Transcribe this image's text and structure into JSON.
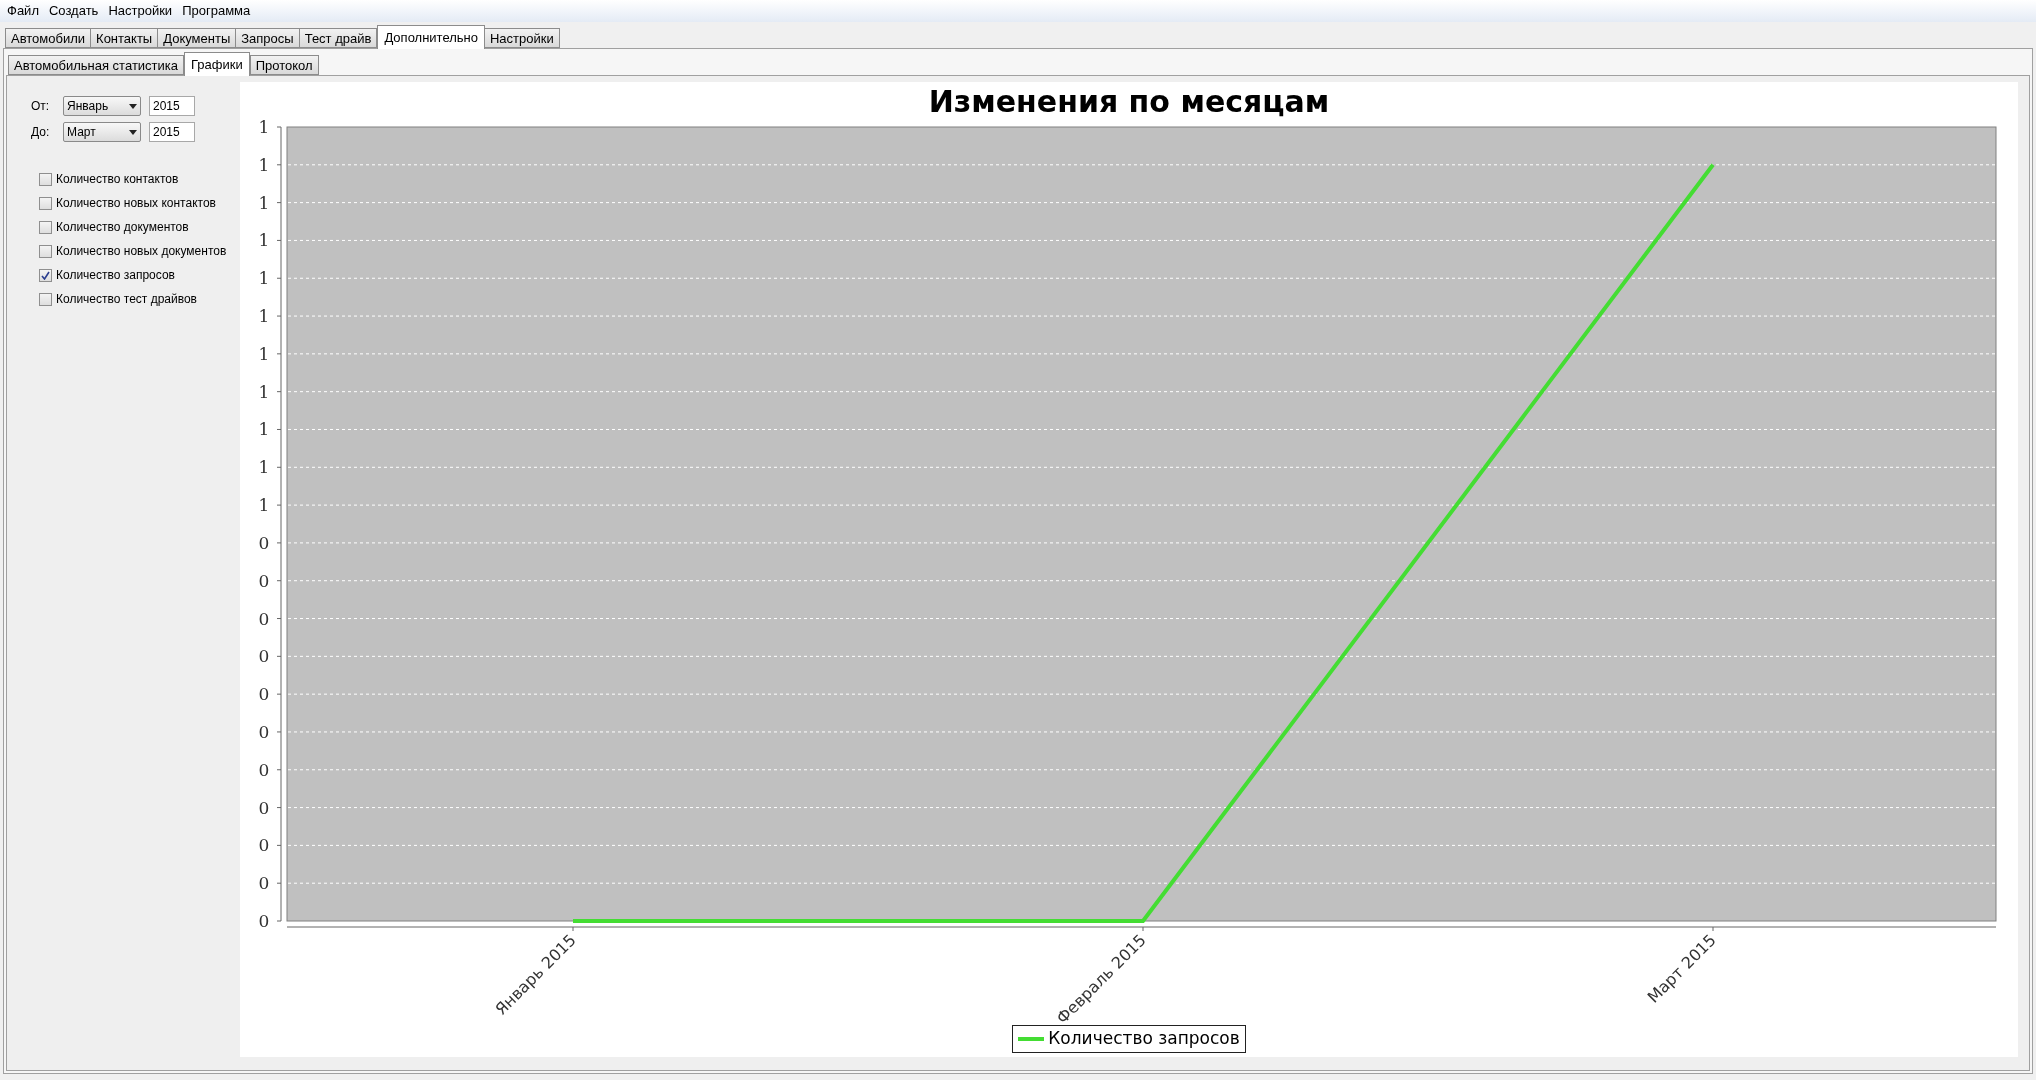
{
  "menu": [
    "Файл",
    "Создать",
    "Настройки",
    "Программа"
  ],
  "tabs": [
    {
      "label": "Автомобили",
      "selected": false
    },
    {
      "label": "Контакты",
      "selected": false
    },
    {
      "label": "Документы",
      "selected": false
    },
    {
      "label": "Запросы",
      "selected": false
    },
    {
      "label": "Тест драйв",
      "selected": false
    },
    {
      "label": "Дополнительно",
      "selected": true
    },
    {
      "label": "Настройки",
      "selected": false
    }
  ],
  "subtabs": [
    {
      "label": "Автомобильная статистика",
      "selected": false
    },
    {
      "label": "Графики",
      "selected": true
    },
    {
      "label": "Протокол",
      "selected": false
    }
  ],
  "range": [
    {
      "label": "От:",
      "month": "Январь",
      "year": "2015"
    },
    {
      "label": "До:",
      "month": "Март",
      "year": "2015"
    }
  ],
  "options": [
    {
      "label": "Количество контактов",
      "checked": false
    },
    {
      "label": "Количество новых контактов",
      "checked": false
    },
    {
      "label": "Количество документов",
      "checked": false
    },
    {
      "label": "Количество новых документов",
      "checked": false
    },
    {
      "label": "Количество запросов",
      "checked": true
    },
    {
      "label": "Количество тест драйвов",
      "checked": false
    }
  ],
  "chart_data": {
    "type": "line",
    "title": "Изменения по месяцам",
    "categories": [
      "Январь 2015",
      "Февраль 2015",
      "Март 2015"
    ],
    "series": [
      {
        "name": "Количество запросов",
        "color": "#44dd33",
        "values": [
          0,
          0,
          1
        ]
      }
    ],
    "ylim": [
      0,
      1.05
    ],
    "grid": true,
    "yticks": [
      {
        "value": 0,
        "label": "0"
      },
      {
        "value": 0.05,
        "label": "0"
      },
      {
        "value": 0.1,
        "label": "0"
      },
      {
        "value": 0.15,
        "label": "0"
      },
      {
        "value": 0.2,
        "label": "0"
      },
      {
        "value": 0.25,
        "label": "0"
      },
      {
        "value": 0.3,
        "label": "0"
      },
      {
        "value": 0.35,
        "label": "0"
      },
      {
        "value": 0.4,
        "label": "0"
      },
      {
        "value": 0.45,
        "label": "0"
      },
      {
        "value": 0.5,
        "label": "0"
      },
      {
        "value": 0.55,
        "label": "1"
      },
      {
        "value": 0.6,
        "label": "1"
      },
      {
        "value": 0.65,
        "label": "1"
      },
      {
        "value": 0.7,
        "label": "1"
      },
      {
        "value": 0.75,
        "label": "1"
      },
      {
        "value": 0.8,
        "label": "1"
      },
      {
        "value": 0.85,
        "label": "1"
      },
      {
        "value": 0.9,
        "label": "1"
      },
      {
        "value": 0.95,
        "label": "1"
      },
      {
        "value": 1.0,
        "label": "1"
      },
      {
        "value": 1.05,
        "label": "1"
      }
    ]
  }
}
